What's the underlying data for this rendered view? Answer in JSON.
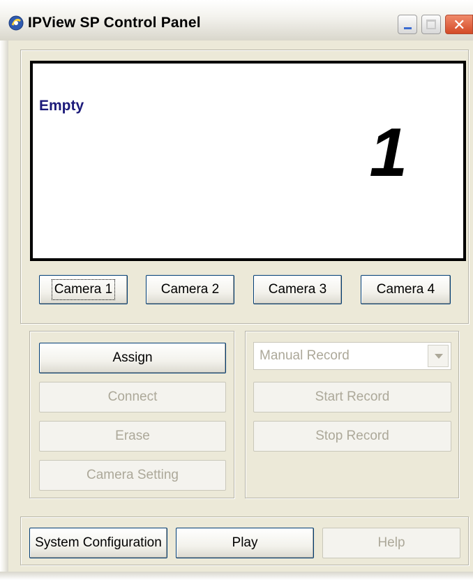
{
  "window": {
    "title": "IPView SP Control Panel"
  },
  "preview": {
    "status": "Empty",
    "channel_number": "1"
  },
  "cameras": [
    {
      "label": "Camera 1"
    },
    {
      "label": "Camera 2"
    },
    {
      "label": "Camera 3"
    },
    {
      "label": "Camera 4"
    }
  ],
  "camera_actions": {
    "assign": "Assign",
    "connect": "Connect",
    "erase": "Erase",
    "camera_setting": "Camera Setting"
  },
  "recording": {
    "mode_selected": "Manual Record",
    "start": "Start Record",
    "stop": "Stop Record"
  },
  "footer": {
    "system_configuration": "System Configuration",
    "play": "Play",
    "help": "Help"
  }
}
